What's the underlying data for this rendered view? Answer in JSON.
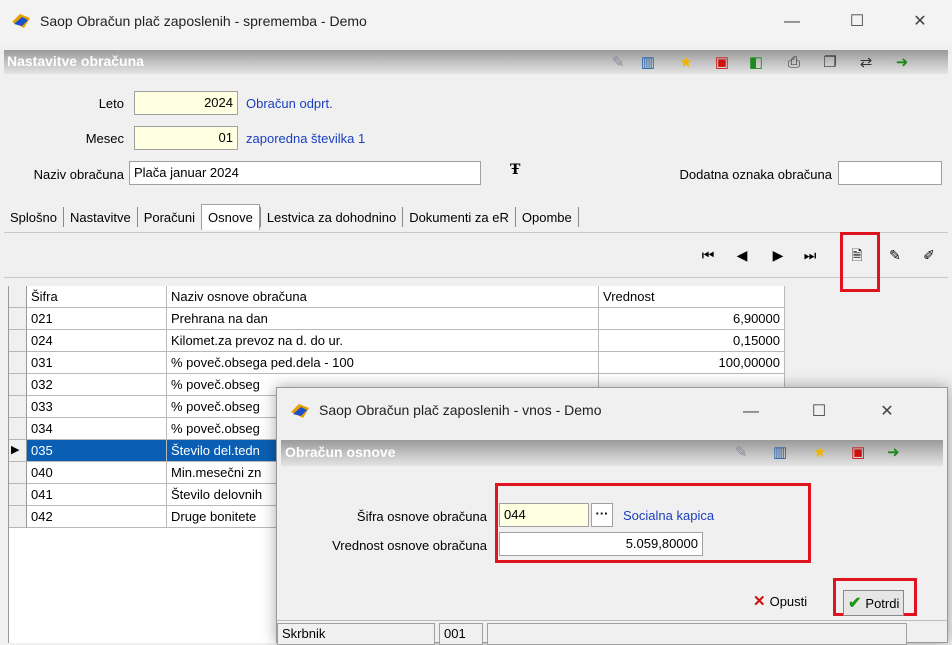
{
  "window": {
    "title": "Saop Obračun plač zaposlenih - sprememba - Demo",
    "min": "—",
    "max": "☐",
    "close": "✕"
  },
  "header": {
    "title": "Nastavitve obračuna"
  },
  "form": {
    "leto_label": "Leto",
    "leto_value": "2024",
    "leto_status": "Obračun odprt.",
    "mesec_label": "Mesec",
    "mesec_value": "01",
    "mesec_info": "zaporedna številka 1",
    "naziv_label": "Naziv obračuna",
    "naziv_value": "Plača januar 2024",
    "dodatna_label": "Dodatna oznaka obračuna",
    "dodatna_value": ""
  },
  "tabs": [
    "Splošno",
    "Nastavitve",
    "Poračuni",
    "Osnove",
    "Lestvica za dohodnino",
    "Dokumenti za eR",
    "Opombe"
  ],
  "active_tab": "Osnove",
  "grid": {
    "columns": [
      "Šifra",
      "Naziv osnove obračuna",
      "Vrednost"
    ],
    "rows": [
      [
        "021",
        "Prehrana na dan",
        "6,90000"
      ],
      [
        "024",
        "Kilomet.za prevoz na d. do ur.",
        "0,15000"
      ],
      [
        "031",
        "% poveč.obsega ped.dela - 100",
        "100,00000"
      ],
      [
        "032",
        "% poveč.obseg",
        ""
      ],
      [
        "033",
        "% poveč.obseg",
        ""
      ],
      [
        "034",
        "% poveč.obseg",
        ""
      ],
      [
        "035",
        "Število del.tedn",
        ""
      ],
      [
        "040",
        "Min.mesečni zn",
        ""
      ],
      [
        "041",
        "Število delovnih",
        ""
      ],
      [
        "042",
        "Druge bonitete",
        ""
      ]
    ],
    "selected_row": 6
  },
  "dialog": {
    "title": "Saop Obračun plač zaposlenih - vnos - Demo",
    "header": "Obračun osnove",
    "sifra_label": "Šifra osnove obračuna",
    "sifra_value": "044",
    "sifra_btn": "···",
    "sifra_name": "Socialna kapica",
    "vrednost_label": "Vrednost osnove obračuna",
    "vrednost_value": "5.059,80000",
    "cancel_label": "Opusti",
    "confirm_label": "Potrdi",
    "status_label": "Skrbnik",
    "status_value": "001"
  },
  "colors": {
    "accent": "#1a3fc0",
    "selection": "#0a5fb4",
    "highlight": "#e0141e"
  }
}
